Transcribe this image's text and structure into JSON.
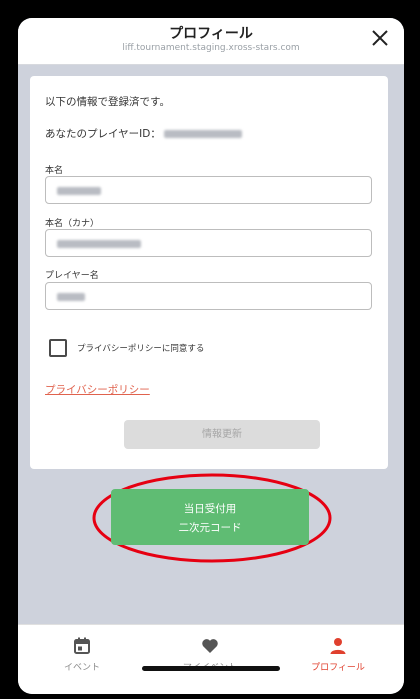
{
  "header": {
    "title": "プロフィール",
    "url": "liff.tournament.staging.xross-stars.com"
  },
  "profile": {
    "registered_text": "以下の情報で登録済です。",
    "player_id_label": "あなたのプレイヤーID：",
    "name_label": "本名",
    "kana_label": "本名（カナ）",
    "player_name_label": "プレイヤー名",
    "privacy_agree_label": "プライバシーポリシーに同意する",
    "privacy_link": "プライバシーポリシー",
    "update_button": "情報更新"
  },
  "qr_button": {
    "line1": "当日受付用",
    "line2": "二次元コード"
  },
  "tabs": [
    {
      "label": "イベント",
      "icon": "calendar-icon",
      "active": false
    },
    {
      "label": "マイイベント",
      "icon": "heart-icon",
      "active": false
    },
    {
      "label": "プロフィール",
      "icon": "person-icon",
      "active": true
    }
  ],
  "colors": {
    "accent_red": "#e0402e",
    "button_green": "#5fbc73",
    "link_orange": "#e0624d"
  }
}
